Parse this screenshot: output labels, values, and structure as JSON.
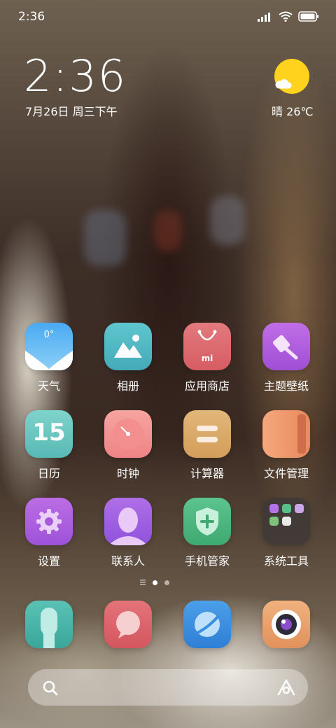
{
  "status_bar": {
    "time": "2:36"
  },
  "clock_widget": {
    "time": "2:36",
    "date": "7月26日 周三下午"
  },
  "weather_widget": {
    "text": "晴 26℃",
    "icon": "sun-cloud-icon"
  },
  "weather_app": {
    "temp": "0°"
  },
  "apps_row1": [
    "天气",
    "相册",
    "应用商店",
    "主题壁纸"
  ],
  "apps_row2": [
    "日历",
    "时钟",
    "计算器",
    "文件管理"
  ],
  "apps_row3": [
    "设置",
    "联系人",
    "手机管家",
    "系统工具"
  ],
  "calendar_icon_number": "15",
  "store_logo": "mi",
  "dock": [
    "phone-icon",
    "messages-icon",
    "browser-icon",
    "camera-icon"
  ],
  "search_bar": {
    "search_icon": "search-icon",
    "assistant_icon": "assistant-icon"
  },
  "page_indicator": {
    "pages": 2,
    "current": 1
  }
}
